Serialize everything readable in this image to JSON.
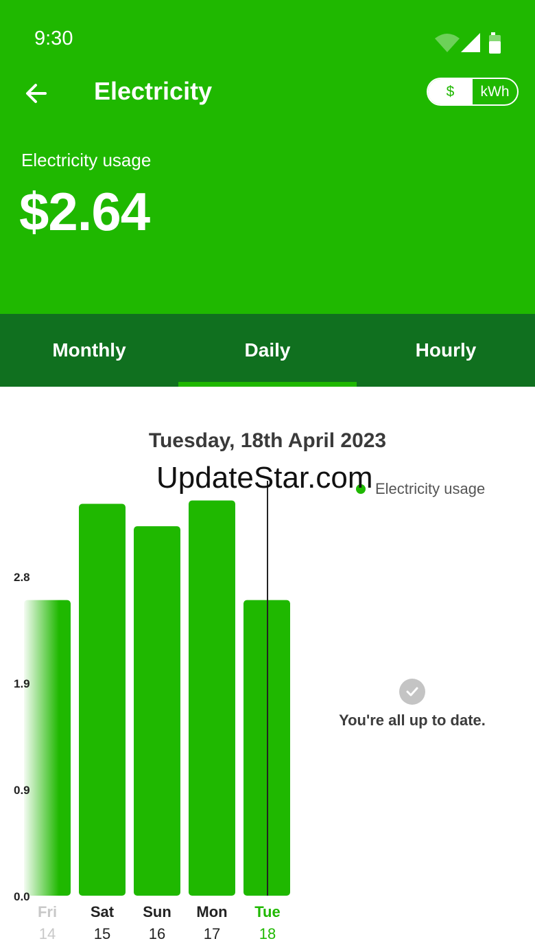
{
  "status_bar": {
    "time": "9:30"
  },
  "header": {
    "title": "Electricity",
    "unit_toggle": {
      "options": [
        "$",
        "kWh"
      ],
      "selected": "$"
    },
    "usage_label": "Electricity usage",
    "usage_value": "$2.64"
  },
  "tabs": [
    {
      "label": "Monthly",
      "active": false
    },
    {
      "label": "Daily",
      "active": true
    },
    {
      "label": "Hourly",
      "active": false
    }
  ],
  "chart_data": {
    "type": "bar",
    "title": "Tuesday, 18th April 2023",
    "categories": [
      "Fri",
      "Sat",
      "Sun",
      "Mon",
      "Tue"
    ],
    "category_dates": [
      "14",
      "15",
      "16",
      "17",
      "18"
    ],
    "series": [
      {
        "name": "Electricity usage",
        "values": [
          2.64,
          3.5,
          3.3,
          3.53,
          2.64
        ]
      }
    ],
    "selected_category": "Tue",
    "y_ticks": [
      "0.0",
      "0.9",
      "1.9",
      "2.8"
    ],
    "ylim": [
      0,
      3.6
    ],
    "legend": "top-right",
    "grid": false
  },
  "empty_state": {
    "message": "You're all up to date."
  },
  "watermark": "UpdateStar.com",
  "colors": {
    "primary_green": "#1fb800",
    "tab_bar_green": "#10701f",
    "selected_label": "#1fb800"
  }
}
